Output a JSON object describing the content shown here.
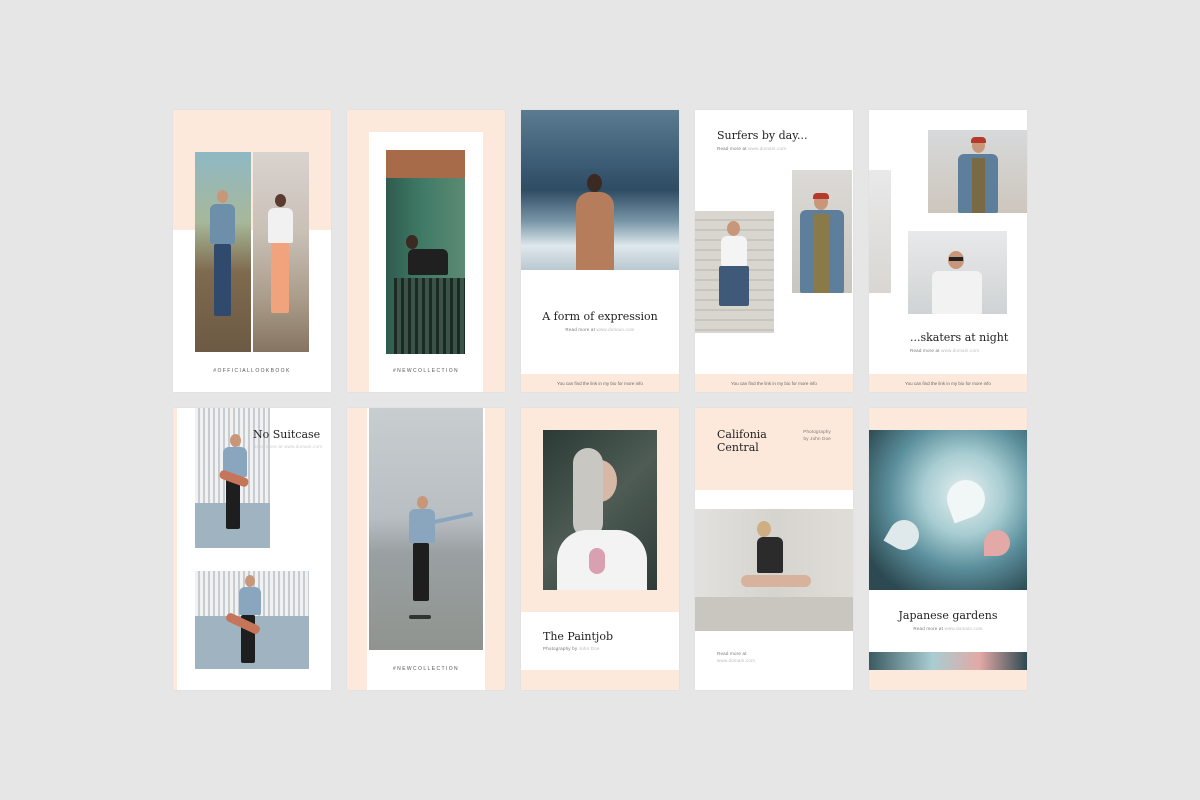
{
  "colors": {
    "background": "#e6e6e6",
    "peach": "#fde9dc",
    "white": "#ffffff",
    "text": "#222222",
    "muted": "#777777"
  },
  "cards": {
    "c1": {
      "tag": "#OFFICIALLOOKBOOK"
    },
    "c2": {
      "tag": "#NEWCOLLECTION"
    },
    "c3": {
      "title": "A form of expression",
      "read_more": "Read more at",
      "link": "www.domain.com",
      "footer": "You can find the link in my bio for more info"
    },
    "c4": {
      "title": "Surfers by day...",
      "read_more": "Read more at",
      "link": "www.domain.com",
      "footer": "You can find the link in my bio for more info"
    },
    "c5": {
      "title": "...skaters at night",
      "read_more": "Read more at",
      "link": "www.domain.com",
      "footer": "You can find the link in my bio for more info"
    },
    "c6": {
      "title": "No Suitcase",
      "read_more": "Read more at",
      "link": "www.domain.com"
    },
    "c7": {
      "tag": "#NEWCOLLECTION"
    },
    "c8": {
      "title": "The Paintjob",
      "caption": "Photography by",
      "author": "John Doe"
    },
    "c9": {
      "title_line1": "Califonia",
      "title_line2": "Central",
      "caption_line1": "Photography",
      "caption_line2": "by John Doe",
      "read_more": "Read more at",
      "link": "www.domain.com"
    },
    "c10": {
      "title": "Japanese gardens",
      "read_more": "Read more at",
      "link": "www.domain.com"
    }
  }
}
